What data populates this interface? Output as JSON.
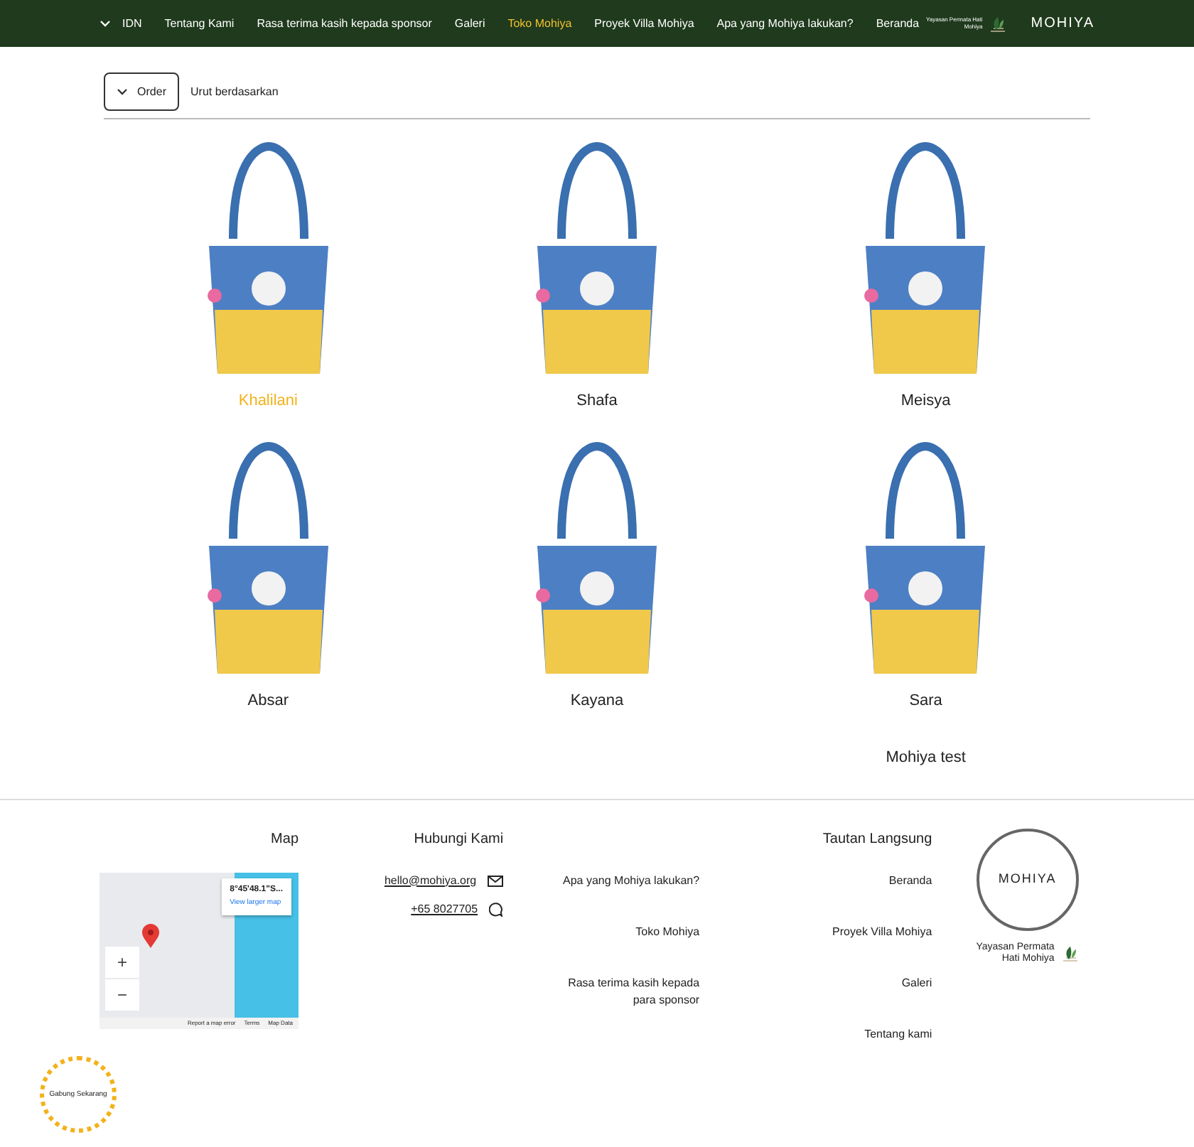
{
  "navbar": {
    "language": "IDN",
    "items": [
      {
        "label": "Tentang Kami",
        "selected": false
      },
      {
        "label": "Rasa terima kasih kepada sponsor",
        "selected": false
      },
      {
        "label": "Galeri",
        "selected": false
      },
      {
        "label": "Toko Mohiya",
        "selected": true
      },
      {
        "label": "Proyek Villa Mohiya",
        "selected": false
      },
      {
        "label": "Apa yang Mohiya lakukan?",
        "selected": false
      },
      {
        "label": "Beranda",
        "selected": false
      }
    ],
    "foundation_name": "Yayasan Permata Hati Mohiya",
    "logo": "MOHIYA"
  },
  "sort": {
    "value": "Order",
    "label": "Urut berdasarkan"
  },
  "products": [
    {
      "name": "Khalilani",
      "kind": "photo",
      "highlighted": true
    },
    {
      "name": "Shafa",
      "kind": "photo",
      "highlighted": false
    },
    {
      "name": "Meisya",
      "kind": "photo",
      "highlighted": false
    },
    {
      "name": "Absar",
      "kind": "photo",
      "highlighted": false
    },
    {
      "name": "Kayana",
      "kind": "photo",
      "highlighted": false
    },
    {
      "name": "Sara",
      "kind": "photo",
      "highlighted": false
    },
    {
      "name": "Mohiya test",
      "kind": "text",
      "highlighted": false
    }
  ],
  "footer": {
    "map": {
      "title": "Map",
      "coordinates": "8°45'48.1\"S...",
      "larger_link": "View larger map",
      "zoom_in": "+",
      "zoom_out": "−",
      "attribution": [
        "Report a map error",
        "Terms",
        "Map Data"
      ]
    },
    "contact": {
      "title": "Hubungi Kami",
      "email": "hello@mohiya.org",
      "phone": "+65 8027705"
    },
    "quick_links": {
      "title": "Tautan Langsung",
      "column_1": [
        "Apa yang Mohiya lakukan?",
        "Toko Mohiya",
        "Rasa terima kasih kepada para sponsor"
      ],
      "column_2": [
        "Beranda",
        "Proyek Villa Mohiya",
        "Galeri",
        "Tentang kami"
      ]
    },
    "logo": "MOHIYA",
    "foundation_name": "Yayasan Permata Hati Mohiya",
    "join_badge": "Gabung Sekarang"
  }
}
